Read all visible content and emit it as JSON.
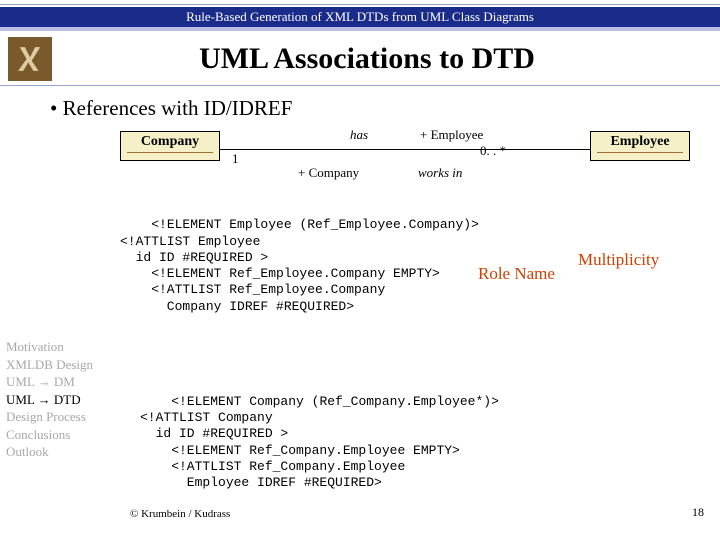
{
  "header": {
    "topline": "Rule-Based Generation of XML DTDs from UML Class Diagrams",
    "title": "UML Associations to DTD"
  },
  "bullet": "References with ID/IDREF",
  "uml": {
    "leftClass": "Company",
    "rightClass": "Employee",
    "assocNameTop": "has",
    "roleTopRight": "+ Employee",
    "multRight": "0. . *",
    "multLeft": "1",
    "roleBottomLeft": "+ Company",
    "assocNameBottom": "works in"
  },
  "code1": "<!ELEMENT Employee (Ref_Employee.Company)>\n<!ATTLIST Employee\n  id ID #REQUIRED >\n    <!ELEMENT Ref_Employee.Company EMPTY>\n    <!ATTLIST Ref_Employee.Company\n      Company IDREF #REQUIRED>",
  "annot": {
    "roleName": "Role Name",
    "multiplicity": "Multiplicity"
  },
  "code2": "<!ELEMENT Company (Ref_Company.Employee*)>\n<!ATTLIST Company\n  id ID #REQUIRED >\n    <!ELEMENT Ref_Company.Employee EMPTY>\n    <!ATTLIST Ref_Company.Employee\n      Employee IDREF #REQUIRED>",
  "sidebar": {
    "items": [
      {
        "label": "Motivation",
        "active": false
      },
      {
        "label": "XMLDB Design",
        "active": false
      },
      {
        "label": "UML → DM",
        "active": false
      },
      {
        "label": "UML → DTD",
        "active": true
      },
      {
        "label": "Design Process",
        "active": false
      },
      {
        "label": "Conclusions",
        "active": false
      },
      {
        "label": "Outlook",
        "active": false
      }
    ]
  },
  "footer": {
    "left": "© Krumbein / Kudrass",
    "right": "18"
  }
}
